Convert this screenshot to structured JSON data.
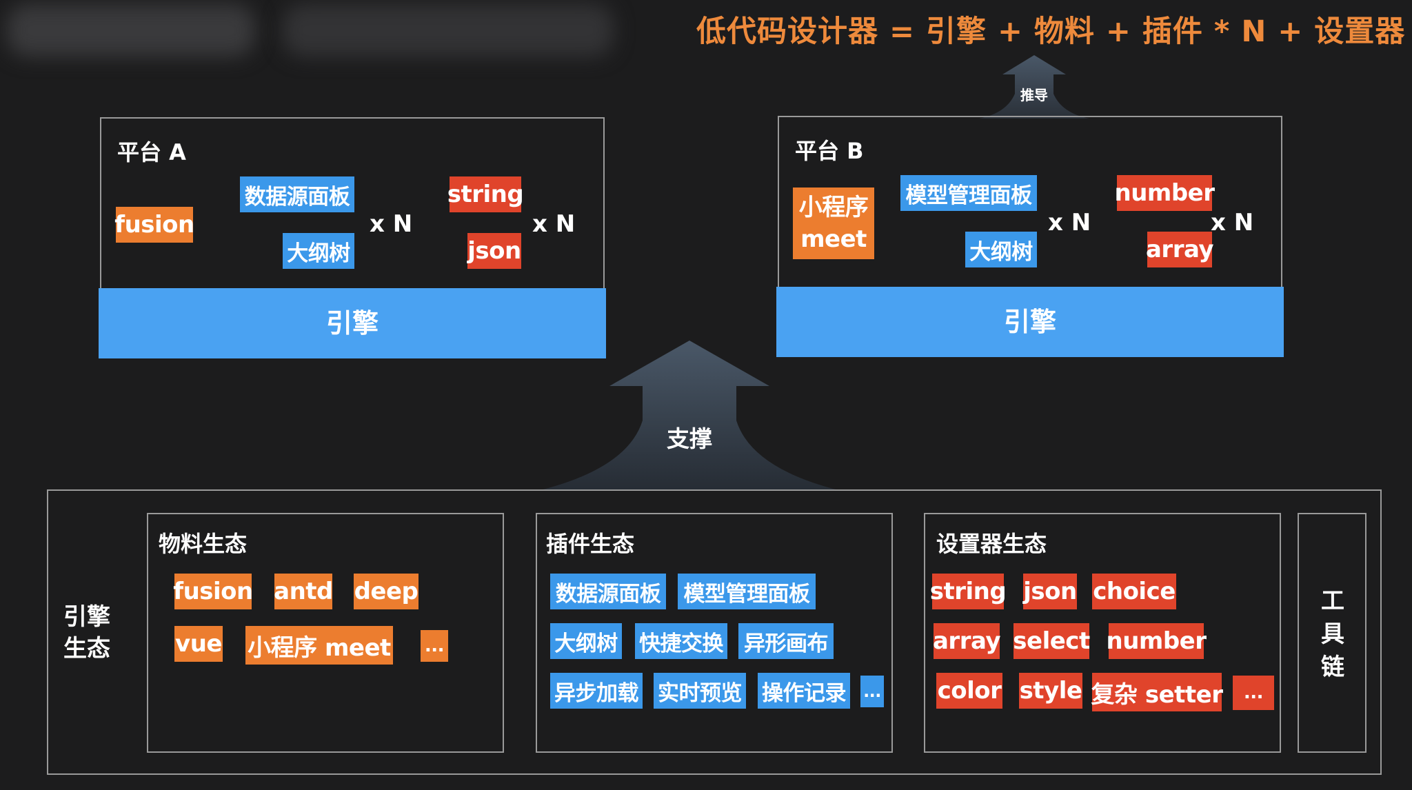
{
  "formula": "低代码设计器 = 引擎 + 物料 + 插件 * N + 设置器 *",
  "arrows": {
    "top_label": "推导",
    "middle_label": "支撑"
  },
  "platform_a": {
    "title": "平台 A",
    "material": "fusion",
    "plugins": [
      "数据源面板",
      "大纲树"
    ],
    "plugins_mult": "x N",
    "setters": [
      "string",
      "json"
    ],
    "setters_mult": "x N",
    "engine": "引擎"
  },
  "platform_b": {
    "title": "平台 B",
    "material_line1": "小程序",
    "material_line2": "meet",
    "plugins": [
      "模型管理面板",
      "大纲树"
    ],
    "plugins_mult": "x N",
    "setters": [
      "number",
      "array"
    ],
    "setters_mult": "x N",
    "engine": "引擎"
  },
  "ecosystem": {
    "label_line1": "引擎",
    "label_line2": "生态",
    "materials": {
      "title": "物料生态",
      "items": [
        "fusion",
        "antd",
        "deep",
        "vue",
        "小程序 meet",
        "..."
      ]
    },
    "plugins": {
      "title": "插件生态",
      "items": [
        "数据源面板",
        "模型管理面板",
        "大纲树",
        "快捷交换",
        "异形画布",
        "异步加载",
        "实时预览",
        "操作记录",
        "..."
      ]
    },
    "setters": {
      "title": "设置器生态",
      "items": [
        "string",
        "json",
        "choice",
        "array",
        "select",
        "number",
        "color",
        "style",
        "复杂 setter",
        "..."
      ]
    },
    "toolchain": [
      "工",
      "具",
      "链"
    ]
  },
  "colors": {
    "background": "#1c1c1d",
    "orange": "#ec7d2f",
    "blue": "#3b98ea",
    "red": "#e0442b",
    "engine": "#4aa2f2",
    "formula": "#ee8a3c",
    "border": "#9a9a9a",
    "arrow": "#3a4450"
  }
}
